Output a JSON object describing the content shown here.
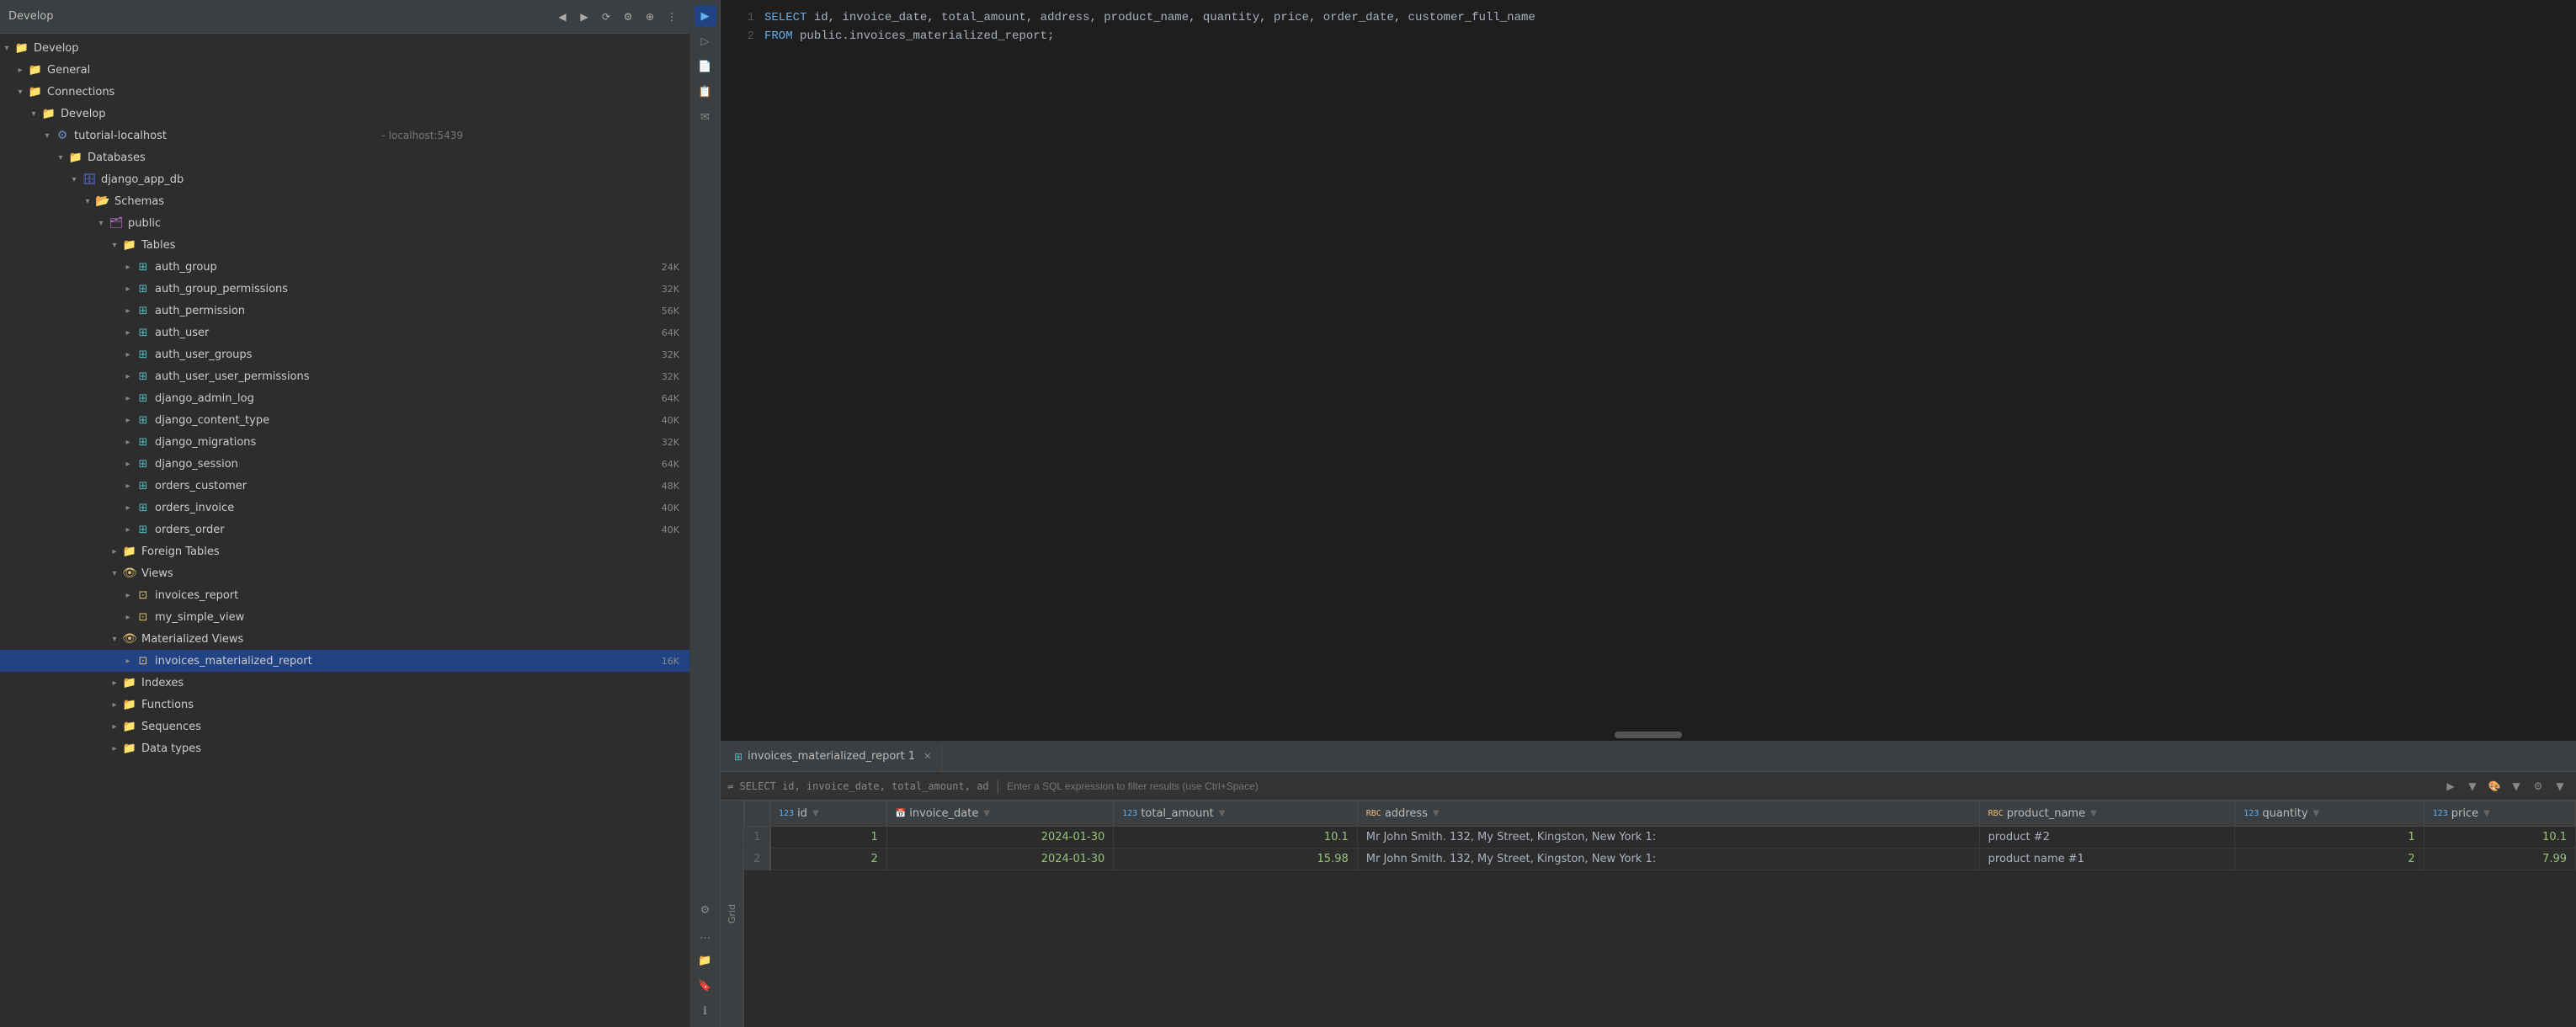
{
  "sidebar": {
    "header_title": "Develop",
    "toolbar_buttons": [
      "←",
      "→",
      "⚙",
      "⊕",
      "⋮"
    ],
    "tree": [
      {
        "id": "develop",
        "label": "Develop",
        "icon": "folder-orange",
        "level": 0,
        "expanded": true,
        "arrow": "open"
      },
      {
        "id": "general",
        "label": "General",
        "icon": "folder-orange",
        "level": 1,
        "expanded": false,
        "arrow": "closed"
      },
      {
        "id": "connections",
        "label": "Connections",
        "icon": "folder-orange",
        "level": 1,
        "expanded": true,
        "arrow": "open"
      },
      {
        "id": "develop2",
        "label": "Develop",
        "icon": "folder-orange",
        "level": 2,
        "expanded": true,
        "arrow": "open"
      },
      {
        "id": "tutorial",
        "label": "tutorial-localhost",
        "sublabel": " - localhost:5439",
        "icon": "server",
        "level": 3,
        "expanded": true,
        "arrow": "open"
      },
      {
        "id": "databases",
        "label": "Databases",
        "icon": "folder-orange",
        "level": 4,
        "expanded": true,
        "arrow": "open"
      },
      {
        "id": "django_app_db",
        "label": "django_app_db",
        "icon": "db",
        "level": 5,
        "expanded": true,
        "arrow": "open"
      },
      {
        "id": "schemas",
        "label": "Schemas",
        "icon": "schema",
        "level": 6,
        "expanded": true,
        "arrow": "open"
      },
      {
        "id": "public",
        "label": "public",
        "icon": "schema",
        "level": 7,
        "expanded": true,
        "arrow": "open"
      },
      {
        "id": "tables",
        "label": "Tables",
        "icon": "folder-orange",
        "level": 8,
        "expanded": true,
        "arrow": "open"
      },
      {
        "id": "auth_group",
        "label": "auth_group",
        "icon": "table",
        "level": 9,
        "expanded": false,
        "arrow": "closed",
        "badge": "24K"
      },
      {
        "id": "auth_group_permissions",
        "label": "auth_group_permissions",
        "icon": "table",
        "level": 9,
        "expanded": false,
        "arrow": "closed",
        "badge": "32K"
      },
      {
        "id": "auth_permission",
        "label": "auth_permission",
        "icon": "table",
        "level": 9,
        "expanded": false,
        "arrow": "closed",
        "badge": "56K"
      },
      {
        "id": "auth_user",
        "label": "auth_user",
        "icon": "table",
        "level": 9,
        "expanded": false,
        "arrow": "closed",
        "badge": "64K"
      },
      {
        "id": "auth_user_groups",
        "label": "auth_user_groups",
        "icon": "table",
        "level": 9,
        "expanded": false,
        "arrow": "closed",
        "badge": "32K"
      },
      {
        "id": "auth_user_user_permissions",
        "label": "auth_user_user_permissions",
        "icon": "table",
        "level": 9,
        "expanded": false,
        "arrow": "closed",
        "badge": "32K"
      },
      {
        "id": "django_admin_log",
        "label": "django_admin_log",
        "icon": "table",
        "level": 9,
        "expanded": false,
        "arrow": "closed",
        "badge": "64K"
      },
      {
        "id": "django_content_type",
        "label": "django_content_type",
        "icon": "table",
        "level": 9,
        "expanded": false,
        "arrow": "closed",
        "badge": "40K"
      },
      {
        "id": "django_migrations",
        "label": "django_migrations",
        "icon": "table",
        "level": 9,
        "expanded": false,
        "arrow": "closed",
        "badge": "32K"
      },
      {
        "id": "django_session",
        "label": "django_session",
        "icon": "table",
        "level": 9,
        "expanded": false,
        "arrow": "closed",
        "badge": "64K"
      },
      {
        "id": "orders_customer",
        "label": "orders_customer",
        "icon": "table",
        "level": 9,
        "expanded": false,
        "arrow": "closed",
        "badge": "48K"
      },
      {
        "id": "orders_invoice",
        "label": "orders_invoice",
        "icon": "table",
        "level": 9,
        "expanded": false,
        "arrow": "closed",
        "badge": "40K"
      },
      {
        "id": "orders_order",
        "label": "orders_order",
        "icon": "table",
        "level": 9,
        "expanded": false,
        "arrow": "closed",
        "badge": "40K"
      },
      {
        "id": "foreign_tables",
        "label": "Foreign Tables",
        "icon": "folder-orange",
        "level": 8,
        "expanded": false,
        "arrow": "closed"
      },
      {
        "id": "views",
        "label": "Views",
        "icon": "folder-eye",
        "level": 8,
        "expanded": true,
        "arrow": "open"
      },
      {
        "id": "invoices_report",
        "label": "invoices_report",
        "icon": "view",
        "level": 9,
        "expanded": false,
        "arrow": "closed"
      },
      {
        "id": "my_simple_view",
        "label": "my_simple_view",
        "icon": "view",
        "level": 9,
        "expanded": false,
        "arrow": "closed"
      },
      {
        "id": "mat_views",
        "label": "Materialized Views",
        "icon": "folder-eye",
        "level": 8,
        "expanded": true,
        "arrow": "open"
      },
      {
        "id": "invoices_materialized_report",
        "label": "invoices_materialized_report",
        "icon": "matview",
        "level": 9,
        "expanded": false,
        "arrow": "closed",
        "badge": "16K",
        "selected": true
      },
      {
        "id": "indexes",
        "label": "Indexes",
        "icon": "folder-orange",
        "level": 8,
        "expanded": false,
        "arrow": "closed"
      },
      {
        "id": "functions",
        "label": "Functions",
        "icon": "folder-orange",
        "level": 8,
        "expanded": false,
        "arrow": "closed"
      },
      {
        "id": "sequences",
        "label": "Sequences",
        "icon": "folder-orange",
        "level": 8,
        "expanded": false,
        "arrow": "closed"
      },
      {
        "id": "data_types",
        "label": "Data types",
        "icon": "folder-orange",
        "level": 8,
        "expanded": false,
        "arrow": "closed"
      }
    ]
  },
  "editor": {
    "line1_num": "1",
    "line2_num": "2",
    "line1_keyword": "SELECT",
    "line1_cols": " id, invoice_date, total_amount, address, product_name, quantity, price, order_date, customer_full_name",
    "line2_keyword": "FROM",
    "line2_table": " public.invoices_materialized_report;"
  },
  "right_strip": {
    "buttons": [
      "▶",
      "▼",
      "📄",
      "📋",
      "✉",
      "⚙",
      "....",
      "📁",
      "🔖",
      "ℹ"
    ]
  },
  "results": {
    "tab_label": "invoices_materialized_report 1",
    "filter_hint": "⇌ SELECT id, invoice_date, total_amount, ad",
    "filter_placeholder": "Enter a SQL expression to filter results (use Ctrl+Space)",
    "action_buttons": [
      "▶",
      "▼",
      "🎨",
      "▼",
      "⚙",
      "▼"
    ],
    "columns": [
      {
        "type": "123",
        "name": "id",
        "has_filter": true
      },
      {
        "type": "📅",
        "name": "invoice_date",
        "has_filter": true
      },
      {
        "type": "123",
        "name": "total_amount",
        "has_filter": true
      },
      {
        "type": "RBC",
        "name": "address",
        "has_filter": true
      },
      {
        "type": "RBC",
        "name": "product_name",
        "has_filter": true
      },
      {
        "type": "123",
        "name": "quantity",
        "has_filter": true
      },
      {
        "type": "123",
        "name": "price",
        "has_filter": true
      }
    ],
    "rows": [
      {
        "row_num": "1",
        "id": "1",
        "invoice_date": "2024-01-30",
        "total_amount": "10.1",
        "address": "Mr John Smith. 132, My Street, Kingston, New York 1:",
        "product_name": "product #2",
        "quantity": "1",
        "price": "10.1"
      },
      {
        "row_num": "2",
        "id": "2",
        "invoice_date": "2024-01-30",
        "total_amount": "15.98",
        "address": "Mr John Smith. 132, My Street, Kingston, New York 1:",
        "product_name": "product name #1",
        "quantity": "2",
        "price": "7.99"
      }
    ],
    "grid_label": "Grid"
  }
}
